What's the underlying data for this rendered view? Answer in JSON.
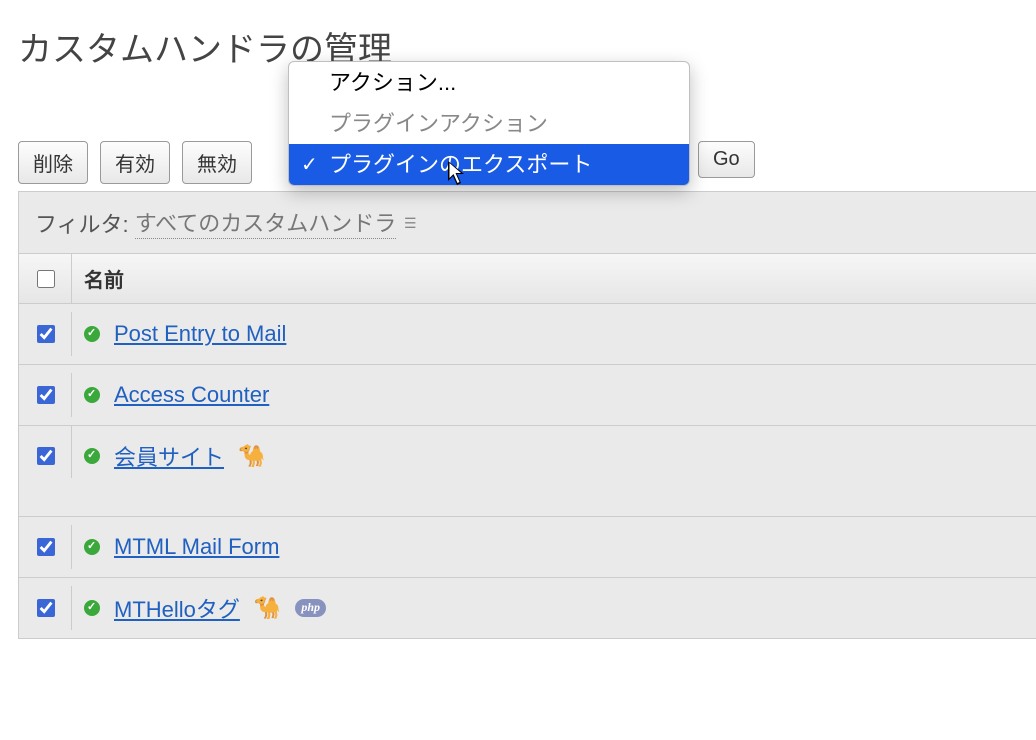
{
  "page": {
    "title": "カスタムハンドラの管理"
  },
  "toolbar": {
    "delete_label": "削除",
    "enable_label": "有効",
    "disable_label": "無効",
    "go_label": "Go"
  },
  "dropdown": {
    "actions_label": "アクション...",
    "group_label": "プラグインアクション",
    "export_label": "プラグインのエクスポート"
  },
  "filter": {
    "prefix": "フィルタ:",
    "current": "すべてのカスタムハンドラ"
  },
  "columns": {
    "name": "名前"
  },
  "rows": [
    {
      "name": "Post Entry to Mail",
      "checked": true,
      "status": "ok",
      "icons": []
    },
    {
      "name": "Access Counter",
      "checked": true,
      "status": "ok",
      "icons": []
    },
    {
      "name": "会員サイト",
      "checked": true,
      "status": "ok",
      "icons": [
        "camel"
      ]
    },
    {
      "name": "MTML Mail Form",
      "checked": true,
      "status": "ok",
      "icons": []
    },
    {
      "name": "MTHelloタグ",
      "checked": true,
      "status": "ok",
      "icons": [
        "camel",
        "php"
      ]
    }
  ]
}
